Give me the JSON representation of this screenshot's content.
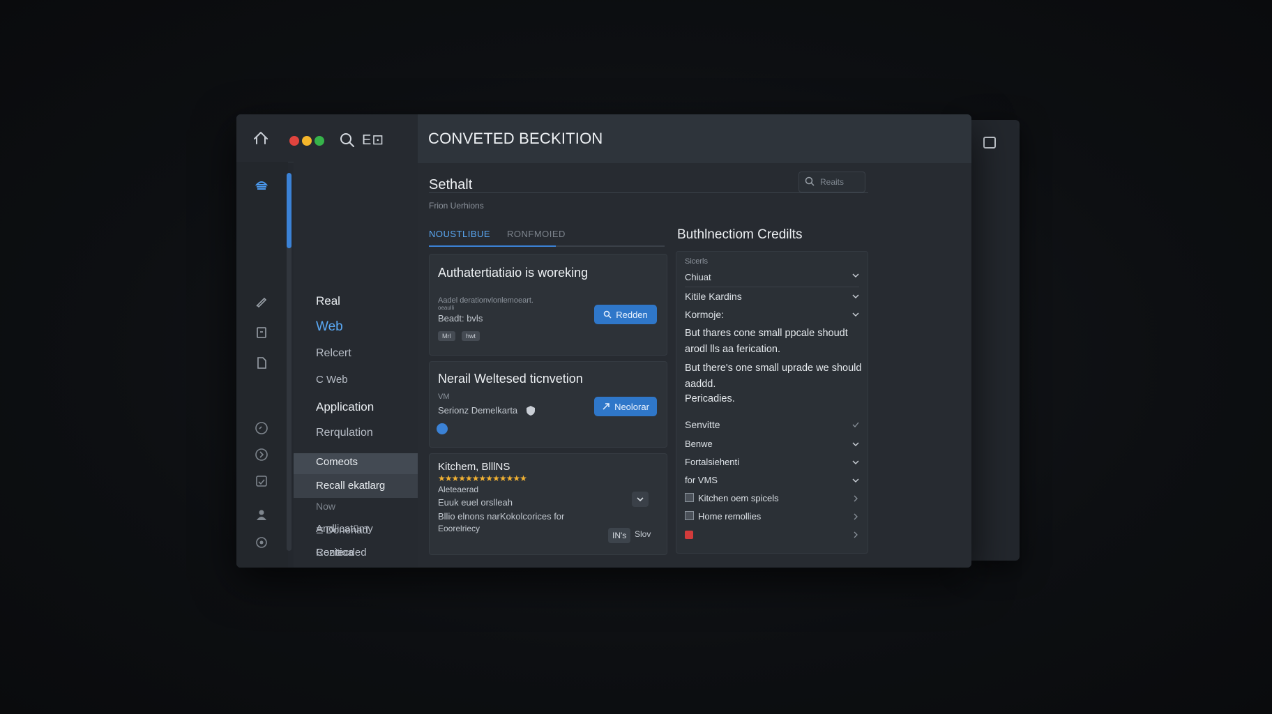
{
  "window": {
    "title": "CONVETED BECKITION",
    "top_label": "E⊡",
    "traffic_lights": [
      "#e0443e",
      "#f4b62b",
      "#36b34a"
    ]
  },
  "nav": {
    "items": [
      {
        "label": "Real"
      },
      {
        "label": "Web"
      },
      {
        "label": "Relcert"
      },
      {
        "label": "C Web"
      },
      {
        "label": "Application"
      },
      {
        "label": "Rerqulation"
      },
      {
        "label": "Comeots"
      },
      {
        "label": "Recall ekatlarg"
      },
      {
        "label": "Now"
      },
      {
        "label": "Andlicatümy"
      },
      {
        "label": "Contecded"
      },
      {
        "label": "Donenad"
      },
      {
        "label": "Rezitioa"
      },
      {
        "label": "Conecced"
      },
      {
        "label": "Now"
      }
    ]
  },
  "main": {
    "section_title": "Sethalt",
    "section_subtitle": "Frion Uerhions",
    "search_placeholder": "Reaits",
    "tabs": [
      {
        "label": "NOUSTLIBUE"
      },
      {
        "label": "RONFMOIED"
      }
    ],
    "cards": {
      "auth": {
        "title": "Authatertiatiaio is woreking",
        "line1": "Aadel derationvlonlemoeart.",
        "line2": "oeaulli",
        "line3": "Beadt: bvls",
        "chip1": "Mrl",
        "chip2": "hwt",
        "button": "Redden"
      },
      "email": {
        "title": "Nerail Weltesed ticnvetion",
        "line1": "VM",
        "line2": "Serionz Demelkarta",
        "button": "Neolorar"
      },
      "kitchen": {
        "title": "Kitchem, BlllNS",
        "stars": "★★★★★★★★★★★★★",
        "line1": "Aleteaerad",
        "line2": "Euuk euel orslleah",
        "line3": "Bllio elnons narKokolcorices for",
        "line4": "Eoorelriecy",
        "tag": "IN's",
        "tag_text": "Slov"
      }
    }
  },
  "right": {
    "title": "Buthlnectiom Credilts",
    "panel_label": "Sicerls",
    "rows_top": [
      {
        "label": "Chiuat"
      },
      {
        "label": "Kitile Kardins"
      },
      {
        "label": "Kormoje:"
      }
    ],
    "paragraph1": "But thares cone small ppcale shoudt arodl lls aa ferication.",
    "paragraph2": "But there's one small uprade we should aaddd.",
    "paragraph3": "Pericadies.",
    "rows_bottom": [
      {
        "label": "Senvitte"
      },
      {
        "label": "Benwe"
      },
      {
        "label": "Fortalsiehenti"
      },
      {
        "label": "for VMS"
      },
      {
        "label": "Kitchen oem spicels"
      },
      {
        "label": "Home remollies"
      }
    ]
  },
  "colors": {
    "accent": "#3b82d6",
    "accent_text": "#5aa9f5",
    "star": "#f2b233",
    "danger": "#d23b3b"
  }
}
